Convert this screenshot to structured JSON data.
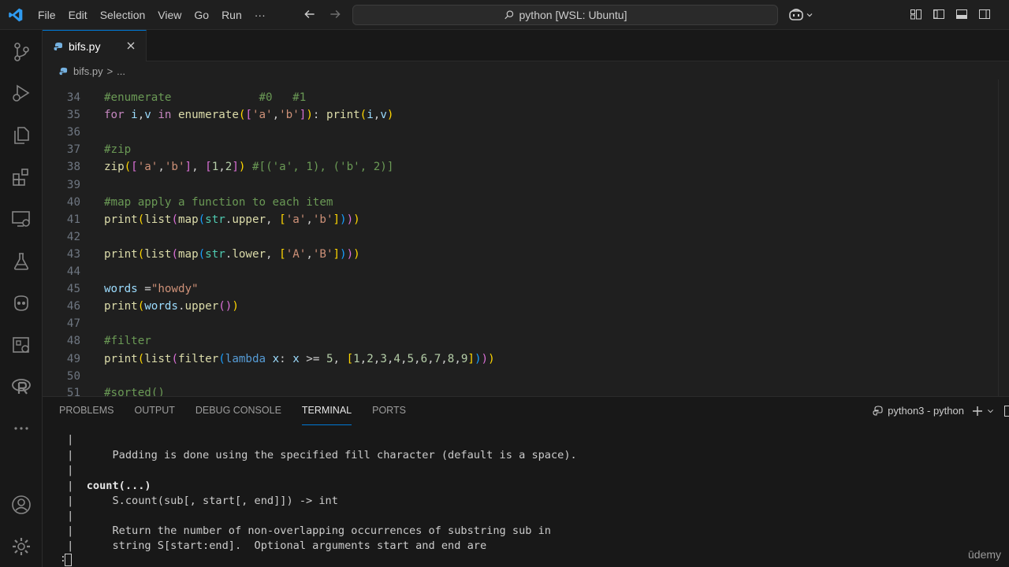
{
  "menu": [
    "File",
    "Edit",
    "Selection",
    "View",
    "Go",
    "Run",
    "···"
  ],
  "search": {
    "label": "python [WSL: Ubuntu]"
  },
  "tab": {
    "name": "bifs.py",
    "close": "×"
  },
  "breadcrumb": {
    "file": "bifs.py",
    "separator": ">",
    "more": "..."
  },
  "editor": {
    "lines": [
      {
        "n": "34",
        "code": "#enumerate             #0   #1"
      },
      {
        "n": "35",
        "code": "for i,v in enumerate(['a','b']): print(i,v)"
      },
      {
        "n": "36",
        "code": ""
      },
      {
        "n": "37",
        "code": "#zip"
      },
      {
        "n": "38",
        "code": "zip(['a','b'], [1,2]) #[('a', 1), ('b', 2)]"
      },
      {
        "n": "39",
        "code": ""
      },
      {
        "n": "40",
        "code": "#map apply a function to each item"
      },
      {
        "n": "41",
        "code": "print(list(map(str.upper, ['a','b'])))"
      },
      {
        "n": "42",
        "code": ""
      },
      {
        "n": "43",
        "code": "print(list(map(str.lower, ['A','B'])))"
      },
      {
        "n": "44",
        "code": ""
      },
      {
        "n": "45",
        "code": "words =\"howdy\""
      },
      {
        "n": "46",
        "code": "print(words.upper())"
      },
      {
        "n": "47",
        "code": ""
      },
      {
        "n": "48",
        "code": "#filter"
      },
      {
        "n": "49",
        "code": "print(list(filter(lambda x: x >= 5, [1,2,3,4,5,6,7,8,9])))"
      },
      {
        "n": "50",
        "code": ""
      },
      {
        "n": "51",
        "code": "#sorted()"
      }
    ]
  },
  "panel": {
    "tabs": [
      "PROBLEMS",
      "OUTPUT",
      "DEBUG CONSOLE",
      "TERMINAL",
      "PORTS"
    ],
    "active_tab": "TERMINAL",
    "terminal_name": "python3 - python",
    "terminal_lines": [
      " |",
      " |      Padding is done using the specified fill character (default is a space).",
      " |",
      " |  count(...)",
      " |      S.count(sub[, start[, end]]) -> int",
      " |",
      " |      Return the number of non-overlapping occurrences of substring sub in",
      " |      string S[start:end].  Optional arguments start and end are"
    ],
    "prompt": ":"
  },
  "watermark": "ūdemy",
  "colors": {
    "accent": "#0078d4",
    "editor_bg": "#1f1f1f",
    "panel_bg": "#181818",
    "comment": "#6a9955",
    "string": "#ce9178"
  }
}
